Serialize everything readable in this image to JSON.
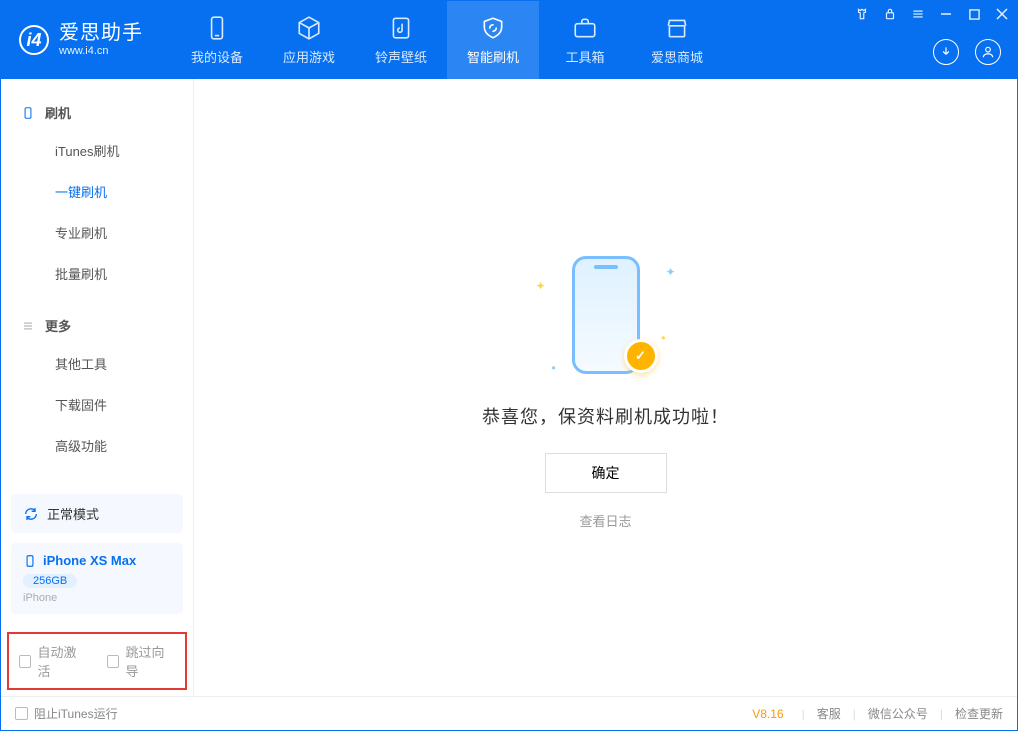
{
  "app": {
    "title": "爱思助手",
    "subtitle": "www.i4.cn"
  },
  "tabs": [
    {
      "label": "我的设备"
    },
    {
      "label": "应用游戏"
    },
    {
      "label": "铃声壁纸"
    },
    {
      "label": "智能刷机"
    },
    {
      "label": "工具箱"
    },
    {
      "label": "爱思商城"
    }
  ],
  "sidebar": {
    "group1": {
      "title": "刷机",
      "items": [
        "iTunes刷机",
        "一键刷机",
        "专业刷机",
        "批量刷机"
      ]
    },
    "group2": {
      "title": "更多",
      "items": [
        "其他工具",
        "下载固件",
        "高级功能"
      ]
    }
  },
  "status": {
    "mode": "正常模式"
  },
  "device": {
    "name": "iPhone XS Max",
    "storage": "256GB",
    "type": "iPhone"
  },
  "options": {
    "opt1": "自动激活",
    "opt2": "跳过向导"
  },
  "main": {
    "success_text": "恭喜您，保资料刷机成功啦！",
    "ok_button": "确定",
    "view_log": "查看日志"
  },
  "footer": {
    "block_itunes": "阻止iTunes运行",
    "version": "V8.16",
    "links": [
      "客服",
      "微信公众号",
      "检查更新"
    ]
  }
}
